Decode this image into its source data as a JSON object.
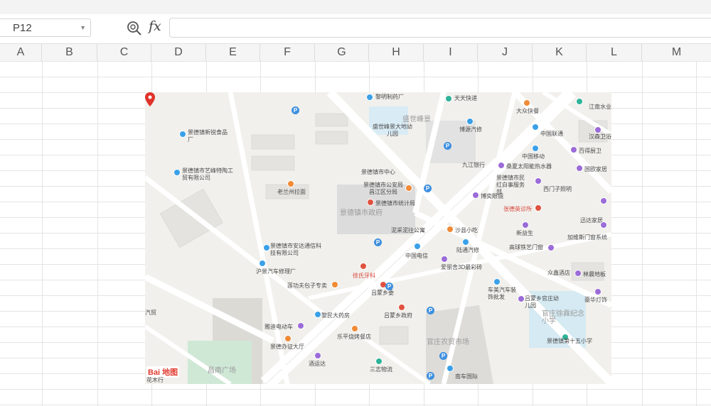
{
  "formula_bar": {
    "cell_ref": "P12",
    "fx_label": "fx",
    "formula_value": ""
  },
  "columns": [
    "A",
    "B",
    "C",
    "D",
    "E",
    "F",
    "G",
    "H",
    "I",
    "J",
    "K",
    "L",
    "M"
  ],
  "map": {
    "logo_text": "Bai 地图",
    "logo_sub": "花木行",
    "large_labels": {
      "gov_area": "景德镇市政府",
      "shengshi": "盛世峰景",
      "market": "官庄农贸市场",
      "changnan": "昌南广场",
      "school_area": "官庄徐霖纪念小学"
    },
    "labels": [
      {
        "text": "黎明制药厂",
        "cls": ""
      },
      {
        "text": "天天快递",
        "cls": ""
      },
      {
        "text": "大众快餐",
        "cls": ""
      },
      {
        "text": "江南水业",
        "cls": ""
      },
      {
        "text": "景德镇新锐食品厂",
        "cls": ""
      },
      {
        "text": "盛世峰景大地幼儿园",
        "cls": ""
      },
      {
        "text": "博源汽修",
        "cls": ""
      },
      {
        "text": "中国联通",
        "cls": ""
      },
      {
        "text": "汉森卫浴",
        "cls": ""
      },
      {
        "text": "景德镇市艺峰特陶工贸有限公司",
        "cls": ""
      },
      {
        "text": "九江银行",
        "cls": ""
      },
      {
        "text": "中国移动",
        "cls": ""
      },
      {
        "text": "百得厨卫",
        "cls": ""
      },
      {
        "text": "景德镇市中心",
        "cls": ""
      },
      {
        "text": "桑夏太阳能热水器",
        "cls": ""
      },
      {
        "text": "国欧家居",
        "cls": ""
      },
      {
        "text": "老兰州拉面",
        "cls": ""
      },
      {
        "text": "景德镇市公安局昌江区分局",
        "cls": ""
      },
      {
        "text": "景德镇市民红白事服务部",
        "cls": ""
      },
      {
        "text": "西门子照明",
        "cls": ""
      },
      {
        "text": "景德镇市统计局",
        "cls": ""
      },
      {
        "text": "博奕眼镜",
        "cls": ""
      },
      {
        "text": "张德英诊所",
        "cls": "red"
      },
      {
        "text": "迅达家居",
        "cls": ""
      },
      {
        "text": "泥采泥往公寓",
        "cls": ""
      },
      {
        "text": "沙县小吃",
        "cls": ""
      },
      {
        "text": "新益生",
        "cls": ""
      },
      {
        "text": "加维斯门窗系统",
        "cls": ""
      },
      {
        "text": "景德镇市安达通信科技有限公司",
        "cls": ""
      },
      {
        "text": "中国电信",
        "cls": ""
      },
      {
        "text": "陆通汽修",
        "cls": ""
      },
      {
        "text": "高球铁艺门窗",
        "cls": ""
      },
      {
        "text": "沪景汽车修理厂",
        "cls": ""
      },
      {
        "text": "徐氏牙科",
        "cls": "red"
      },
      {
        "text": "爱丽舍3D最彩砖",
        "cls": ""
      },
      {
        "text": "众鑫酒店",
        "cls": ""
      },
      {
        "text": "林晨地板",
        "cls": ""
      },
      {
        "text": "莲功夫包子专卖",
        "cls": ""
      },
      {
        "text": "吕蒙乡委",
        "cls": ""
      },
      {
        "text": "车美汽车装饰批发",
        "cls": ""
      },
      {
        "text": "吕蒙乡官庄幼儿园",
        "cls": ""
      },
      {
        "text": "豪华灯饰",
        "cls": ""
      },
      {
        "text": "黎民大药房",
        "cls": ""
      },
      {
        "text": "吕蒙乡政府",
        "cls": ""
      },
      {
        "text": "雅迪电动车",
        "cls": ""
      },
      {
        "text": "景德镇第十五小学",
        "cls": ""
      },
      {
        "text": "景德办证大厅",
        "cls": ""
      },
      {
        "text": "乐平烧烤餐店",
        "cls": ""
      },
      {
        "text": "酒运达",
        "cls": ""
      },
      {
        "text": "三志物流",
        "cls": ""
      },
      {
        "text": "南车国际",
        "cls": ""
      },
      {
        "text": "汽贸",
        "cls": ""
      }
    ]
  }
}
